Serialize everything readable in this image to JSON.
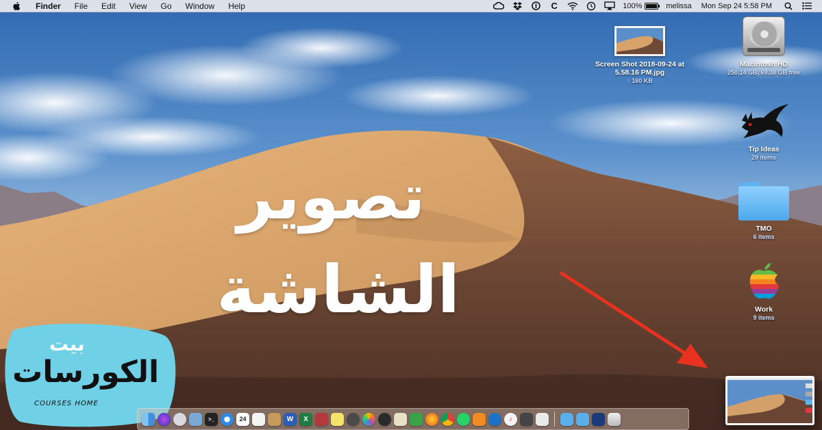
{
  "menubar": {
    "app_name": "Finder",
    "menus": [
      "File",
      "Edit",
      "View",
      "Go",
      "Window",
      "Help"
    ],
    "battery_percent": "100%",
    "battery_level": 1.0,
    "user": "melissa",
    "datetime": "Mon Sep 24  5:58 PM",
    "status_icons": [
      "creative-cloud-icon",
      "dropbox-icon",
      "onepassword-icon",
      "ccleaner-icon",
      "wifi-icon",
      "time-machine-icon",
      "airplay-icon"
    ]
  },
  "desktop_icons": [
    {
      "label": "Screen Shot 2018-09-24 at",
      "label2": "5.58.16 PM.jpg",
      "sub": "↑ 160 KB",
      "icon": "screenshot-file-icon"
    },
    {
      "label": "Macintosh HD",
      "sub": "250.14 GB, 69.38 GB free",
      "icon": "hard-drive-icon"
    },
    {
      "label": "Tip Ideas",
      "sub": "29 items",
      "icon": "fox-folder-icon"
    },
    {
      "label": "TMO",
      "sub": "6 items",
      "icon": "folder-icon"
    },
    {
      "label": "Work",
      "sub": "9 items",
      "icon": "rainbow-apple-icon"
    }
  ],
  "overlay": {
    "line1": "تصوير",
    "line2": "الشاشة"
  },
  "brand": {
    "small": "بيت",
    "large": "الكورسات",
    "latin": "COURSES HOME",
    "color": "#6fd0e6"
  },
  "dock": {
    "calendar_day": "24",
    "apps": [
      "finder",
      "siri",
      "launchpad",
      "preview",
      "terminal",
      "safari",
      "calendar",
      "textedit",
      "notes-board",
      "word",
      "excel",
      "photobooth",
      "stickies",
      "quicktime",
      "photos",
      "stocks",
      "photo-viewer",
      "numbers",
      "firefox",
      "chrome",
      "whatsapp",
      "pages",
      "onepassword",
      "itunes",
      "pen-tool",
      "keynote"
    ],
    "stack_items": [
      "downloads-folder",
      "documents-folder",
      "screen-recorder",
      "trash"
    ]
  },
  "colors": {
    "arrow": "#e8321f",
    "menubar": "#ececee"
  }
}
